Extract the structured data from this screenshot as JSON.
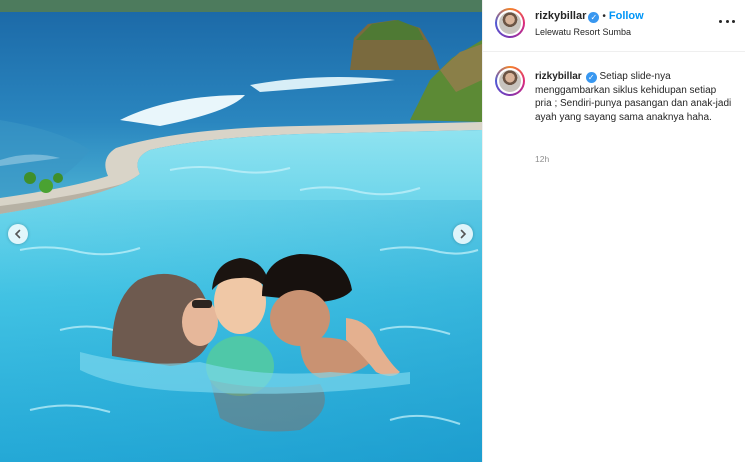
{
  "post": {
    "username": "rizkybillar",
    "follow_label": "Follow",
    "separator": "•",
    "location": "Lelewatu Resort Sumba",
    "more_label": "More options"
  },
  "caption": {
    "username": "rizkybillar",
    "text": "Setiap slide-nya menggambarkan siklus kehidupan setiap pria ; Sendiri-punya pasangan dan anak-jadi ayah yang sayang sama anaknya haha.",
    "time": "12h"
  },
  "icons": {
    "verified": "verified-badge-icon",
    "prev": "chevron-left-icon",
    "next": "chevron-right-icon",
    "more": "more-horizontal-icon"
  },
  "colors": {
    "accent": "#0095f6",
    "verified": "#3897f0",
    "muted": "#8e8e8e"
  }
}
